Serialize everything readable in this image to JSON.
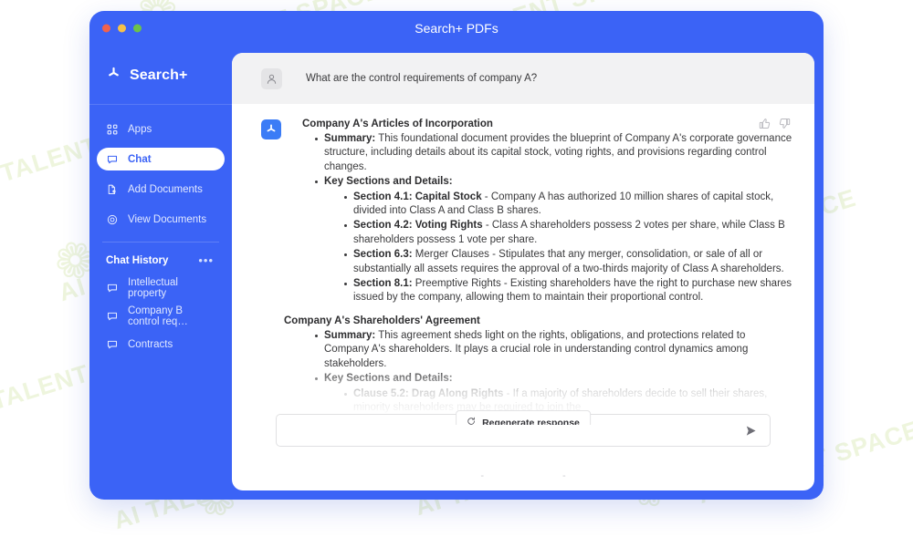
{
  "watermark": {
    "text": "AI TALENT SPACE",
    "blob": "❁"
  },
  "window": {
    "title": "Search+ PDFs",
    "traffic_lights": [
      "close-red",
      "minimize-yellow",
      "maximize-green"
    ]
  },
  "sidebar": {
    "brand": {
      "name": "Search+",
      "icon": "searchplus-logo-icon"
    },
    "nav": [
      {
        "label": "Apps",
        "icon": "grid-icon",
        "active": false
      },
      {
        "label": "Chat",
        "icon": "chat-icon",
        "active": true
      },
      {
        "label": "Add Documents",
        "icon": "document-add-icon",
        "active": false
      },
      {
        "label": "View Documents",
        "icon": "eye-icon",
        "active": false
      }
    ],
    "history": {
      "title": "Chat History",
      "menu_icon": "ellipsis-icon",
      "items": [
        {
          "label": "Intellectual property",
          "icon": "chat-icon"
        },
        {
          "label": "Company B control req…",
          "icon": "chat-icon"
        },
        {
          "label": "Contracts",
          "icon": "chat-icon"
        }
      ]
    }
  },
  "conversation": {
    "user": {
      "avatar_icon": "user-avatar-icon",
      "message": "What are the control requirements of company A?"
    },
    "assistant": {
      "avatar_icon": "searchplus-logo-icon",
      "feedback": {
        "up_icon": "thumbs-up-icon",
        "down_icon": "thumbs-down-icon"
      },
      "sections": [
        {
          "heading": "Company A's Articles of Incorporation",
          "bullets": [
            {
              "runs": [
                {
                  "text": "Summary:",
                  "bold": true
                },
                {
                  "text": " This foundational document provides the blueprint of Company A's corporate governance structure, including details about its capital stock, voting rights, and provisions regarding control changes.",
                  "bold": false
                }
              ]
            },
            {
              "runs": [
                {
                  "text": "Key Sections and Details:",
                  "bold": true
                }
              ],
              "children": [
                {
                  "runs": [
                    {
                      "text": "Section 4.1: Capital Stock",
                      "bold": true
                    },
                    {
                      "text": " - Company A has authorized 10 million shares of capital stock, divided into Class A and Class B shares.",
                      "bold": false
                    }
                  ]
                },
                {
                  "runs": [
                    {
                      "text": "Section 4.2: Voting Rights",
                      "bold": true
                    },
                    {
                      "text": " - Class A shareholders possess 2 votes per share, while Class B shareholders possess 1 vote per share.",
                      "bold": false
                    }
                  ]
                },
                {
                  "runs": [
                    {
                      "text": "Section 6.3:",
                      "bold": true
                    },
                    {
                      "text": " Merger Clauses - Stipulates that any merger, consolidation, or sale of all or substantially all assets requires the approval of a two-thirds majority of Class A shareholders.",
                      "bold": false
                    }
                  ]
                },
                {
                  "runs": [
                    {
                      "text": "Section 8.1:",
                      "bold": true
                    },
                    {
                      "text": " Preemptive Rights - Existing shareholders have the right to purchase new shares issued by the company, allowing them to maintain their proportional control.",
                      "bold": false
                    }
                  ]
                }
              ]
            }
          ]
        },
        {
          "heading": "Company A's Shareholders' Agreement",
          "bullets": [
            {
              "runs": [
                {
                  "text": "Summary:",
                  "bold": true
                },
                {
                  "text": " This agreement sheds light on the rights, obligations, and protections related to Company A's shareholders. It plays a crucial role in understanding control dynamics among stakeholders.",
                  "bold": false
                }
              ]
            },
            {
              "runs": [
                {
                  "text": "Key Sections and Details:",
                  "bold": true
                }
              ],
              "children": [
                {
                  "runs": [
                    {
                      "text": "Clause 5.2: Drag Along Rights",
                      "bold": true
                    },
                    {
                      "text": " - If a majority of shareholders decide to sell their shares, minority shareholders may be required to join the",
                      "bold": false
                    }
                  ]
                }
              ]
            }
          ]
        }
      ]
    }
  },
  "regenerate": {
    "label": "Regenerate response",
    "icon": "refresh-icon"
  },
  "composer": {
    "value": "",
    "placeholder": "",
    "send_icon": "send-arrow-icon"
  },
  "pager": {
    "left": "-",
    "right": "-"
  },
  "colors": {
    "brand_blue": "#3b63f6",
    "avatar_blue": "#3b7cf6",
    "panel_bg": "#ffffff",
    "question_bar": "#f2f2f3",
    "text_dark": "#2d2d2f",
    "text_body": "#3a3a3c",
    "watermark": "#eef5dd"
  }
}
